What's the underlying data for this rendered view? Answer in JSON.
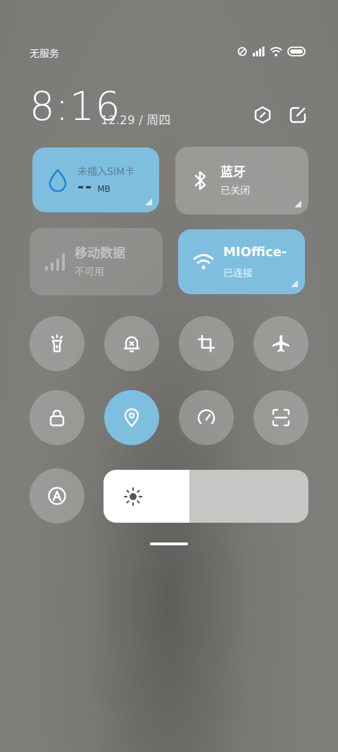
{
  "status_bar": {
    "carrier": "无服务",
    "icons": [
      "no-sim-icon",
      "signal-icon",
      "wifi-icon",
      "battery-icon"
    ]
  },
  "clock": {
    "time": "8:16",
    "date": "12.29 / 周四"
  },
  "top_actions": [
    "settings-hex-icon",
    "edit-icon"
  ],
  "tiles": {
    "data": {
      "title": "未插入SIM卡",
      "value": "--",
      "unit": "MB",
      "icon": "water-drop-icon",
      "active": true
    },
    "bluetooth": {
      "title": "蓝牙",
      "subtitle": "已关闭",
      "icon": "bluetooth-icon",
      "active": false
    },
    "mobile_data": {
      "title": "移动数据",
      "subtitle": "不可用",
      "icon": "signal-bars-icon",
      "active": false,
      "disabled": true
    },
    "wifi": {
      "title": "MIOffice-",
      "subtitle": "已连接",
      "icon": "wifi-icon",
      "active": true
    }
  },
  "toggles": [
    {
      "name": "flashlight",
      "icon": "flashlight-icon",
      "active": false
    },
    {
      "name": "mute",
      "icon": "bell-mute-icon",
      "active": false
    },
    {
      "name": "rotation",
      "icon": "rotate-crop-icon",
      "active": false
    },
    {
      "name": "airplane",
      "icon": "airplane-icon",
      "active": false
    },
    {
      "name": "lock",
      "icon": "lock-icon",
      "active": false
    },
    {
      "name": "location",
      "icon": "location-icon",
      "active": true
    },
    {
      "name": "performance",
      "icon": "speedometer-icon",
      "active": false
    },
    {
      "name": "scanner",
      "icon": "scan-icon",
      "active": false
    },
    {
      "name": "auto-brightness",
      "icon": "auto-a-icon",
      "active": false
    }
  ],
  "brightness": {
    "level": 0.42,
    "icon": "sun-icon"
  },
  "colors": {
    "accent": "#7ebfe0",
    "tile_gray": "#bebebc"
  }
}
